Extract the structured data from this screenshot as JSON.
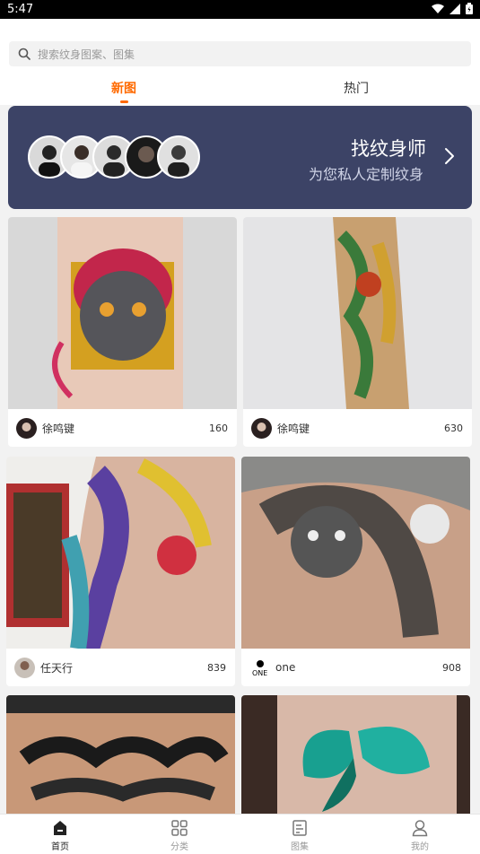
{
  "status": {
    "time": "5:47"
  },
  "search": {
    "placeholder": "搜索纹身图案、图集"
  },
  "tabs": [
    {
      "label": "新图",
      "active": true
    },
    {
      "label": "热门",
      "active": false
    }
  ],
  "banner": {
    "title": "找纹身师",
    "subtitle": "为您私人定制纹身"
  },
  "cards": [
    {
      "author": "徐鸣键",
      "count": "160"
    },
    {
      "author": "徐鸣键",
      "count": "630"
    },
    {
      "author": "任天行",
      "count": "839"
    },
    {
      "author": "one",
      "count": "908"
    },
    {
      "author": "",
      "count": ""
    },
    {
      "author": "",
      "count": ""
    }
  ],
  "nav": [
    {
      "label": "首页",
      "icon": "home-icon",
      "active": true
    },
    {
      "label": "分类",
      "icon": "grid-icon",
      "active": false
    },
    {
      "label": "图集",
      "icon": "album-icon",
      "active": false
    },
    {
      "label": "我的",
      "icon": "user-icon",
      "active": false
    }
  ],
  "colors": {
    "accent": "#ff6a00",
    "banner_bg": "#3c4366"
  }
}
